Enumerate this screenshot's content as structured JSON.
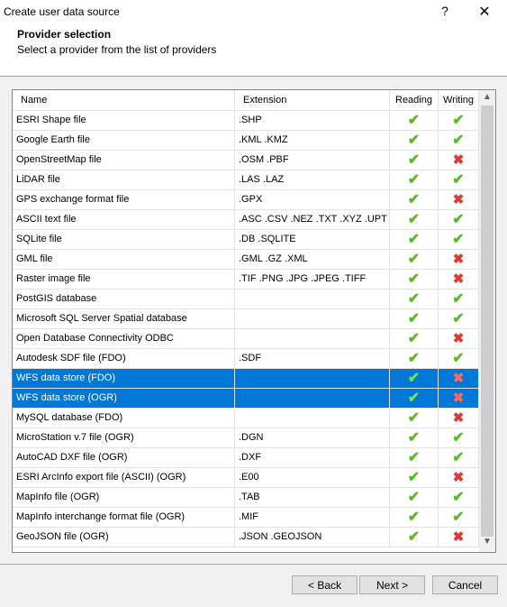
{
  "window": {
    "title": "Create user data source",
    "help_glyph": "?",
    "close_glyph": "✕"
  },
  "header": {
    "title": "Provider selection",
    "subtitle": "Select a provider from the list of providers"
  },
  "table": {
    "columns": [
      "Name",
      "Extension",
      "Reading",
      "Writing"
    ],
    "rows": [
      {
        "name": "ESRI Shape file",
        "ext": ".SHP",
        "reading": "✔",
        "writing": "✔"
      },
      {
        "name": "Google Earth file",
        "ext": ".KML .KMZ",
        "reading": "✔",
        "writing": "✔"
      },
      {
        "name": "OpenStreetMap file",
        "ext": ".OSM .PBF",
        "reading": "✔",
        "writing": "✖"
      },
      {
        "name": "LiDAR file",
        "ext": ".LAS .LAZ",
        "reading": "✔",
        "writing": "✔"
      },
      {
        "name": "GPS exchange format file",
        "ext": ".GPX",
        "reading": "✔",
        "writing": "✖"
      },
      {
        "name": "ASCII text file",
        "ext": ".ASC .CSV .NEZ .TXT .XYZ .UPT",
        "reading": "✔",
        "writing": "✔"
      },
      {
        "name": "SQLite file",
        "ext": ".DB .SQLITE",
        "reading": "✔",
        "writing": "✔"
      },
      {
        "name": "GML file",
        "ext": ".GML .GZ .XML",
        "reading": "✔",
        "writing": "✖"
      },
      {
        "name": "Raster image file",
        "ext": ".TIF .PNG .JPG .JPEG .TIFF",
        "reading": "✔",
        "writing": "✖"
      },
      {
        "name": "PostGIS database",
        "ext": "",
        "reading": "✔",
        "writing": "✔"
      },
      {
        "name": "Microsoft SQL Server Spatial database",
        "ext": "",
        "reading": "✔",
        "writing": "✔"
      },
      {
        "name": "Open Database Connectivity ODBC",
        "ext": "",
        "reading": "✔",
        "writing": "✖"
      },
      {
        "name": "Autodesk SDF file (FDO)",
        "ext": ".SDF",
        "reading": "✔",
        "writing": "✔"
      },
      {
        "name": "WFS data store (FDO)",
        "ext": "",
        "reading": "✔",
        "writing": "✖",
        "selected": true
      },
      {
        "name": "WFS data store (OGR)",
        "ext": "",
        "reading": "✔",
        "writing": "✖",
        "selected": true
      },
      {
        "name": "MySQL database (FDO)",
        "ext": "",
        "reading": "✔",
        "writing": "✖"
      },
      {
        "name": "MicroStation v.7 file (OGR)",
        "ext": ".DGN",
        "reading": "✔",
        "writing": "✔"
      },
      {
        "name": "AutoCAD DXF file (OGR)",
        "ext": ".DXF",
        "reading": "✔",
        "writing": "✔"
      },
      {
        "name": "ESRI ArcInfo export file (ASCII) (OGR)",
        "ext": ".E00",
        "reading": "✔",
        "writing": "✖"
      },
      {
        "name": "MapInfo file (OGR)",
        "ext": ".TAB",
        "reading": "✔",
        "writing": "✔"
      },
      {
        "name": "MapInfo interchange format file (OGR)",
        "ext": ".MIF",
        "reading": "✔",
        "writing": "✔"
      },
      {
        "name": "GeoJSON file (OGR)",
        "ext": ".JSON .GEOJSON",
        "reading": "✔",
        "writing": "✖"
      }
    ]
  },
  "scrollbar": {
    "up_glyph": "▲",
    "down_glyph": "▼"
  },
  "buttons": {
    "back": "< Back",
    "next": "Next >",
    "cancel": "Cancel"
  },
  "colors": {
    "selection": "#0078d7",
    "check": "#5cb82a",
    "cross": "#e03a2e"
  }
}
